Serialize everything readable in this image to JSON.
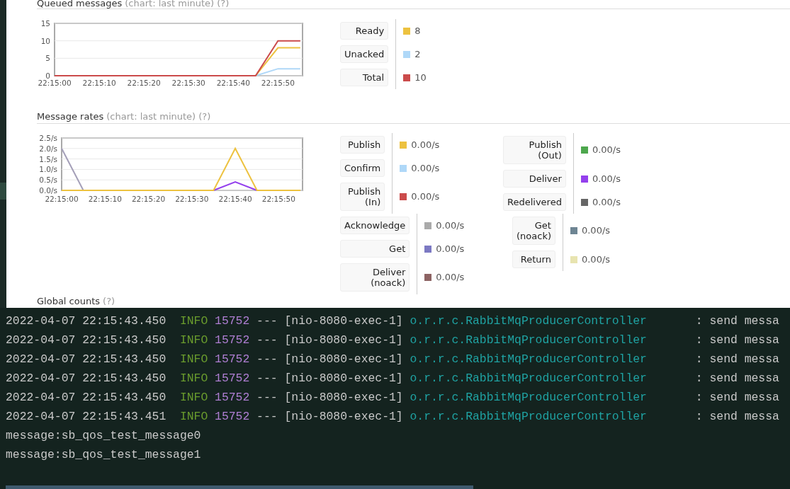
{
  "browser": {
    "sections": [
      {
        "title": "Queued messages",
        "note": "(chart: last minute)",
        "help": "(?)",
        "chart_data": {
          "type": "line",
          "categories": [
            "22:15:00",
            null,
            "22:15:10",
            null,
            "22:15:20",
            null,
            "22:15:30",
            null,
            "22:15:40",
            null,
            "22:15:50",
            null
          ],
          "grid": true,
          "ylim": [
            0,
            15
          ],
          "yticks": [
            0,
            5,
            10,
            15
          ],
          "series": [
            {
              "color": "#afd8f8",
              "values": [
                null,
                null,
                null,
                null,
                null,
                null,
                null,
                null,
                null,
                0,
                2,
                2
              ]
            },
            {
              "color": "#edc240",
              "values": [
                null,
                null,
                null,
                null,
                null,
                null,
                null,
                null,
                null,
                0,
                8,
                8
              ]
            },
            {
              "color": "#cb4b4b",
              "values": [
                0,
                0,
                0,
                0,
                0,
                0,
                0,
                0,
                0,
                0,
                10,
                10
              ]
            }
          ]
        },
        "legend_columns": [
          [
            [
              {
                "label": "Ready",
                "color": "#edc240",
                "value": "8"
              },
              {
                "label": "Unacked",
                "color": "#afd8f8",
                "value": "2"
              },
              {
                "label": "Total",
                "color": "#cb4b4b",
                "value": "10"
              }
            ]
          ]
        ]
      },
      {
        "title": "Message rates",
        "note": "(chart: last minute)",
        "help": "(?)",
        "chart_data": {
          "type": "line",
          "categories": [
            "22:15:00",
            null,
            "22:15:10",
            null,
            "22:15:20",
            null,
            "22:15:30",
            null,
            "22:15:40",
            null,
            "22:15:50",
            null
          ],
          "grid": true,
          "ylim": [
            0,
            2.5
          ],
          "yticks": [
            {
              "value": 0,
              "label": "0.0/s"
            },
            {
              "value": 0.5,
              "label": "0.5/s"
            },
            {
              "value": 1,
              "label": "1.0/s"
            },
            {
              "value": 1.5,
              "label": "1.5/s"
            },
            {
              "value": 2,
              "label": "2.0/s"
            },
            {
              "value": 2.5,
              "label": "2.5/s"
            }
          ],
          "series": [
            {
              "color": "#a49fb8",
              "values": [
                2,
                0,
                null,
                null,
                null,
                null,
                null,
                null,
                null,
                null,
                null,
                null
              ]
            },
            {
              "color": "#9440ed",
              "values": [
                null,
                null,
                null,
                null,
                null,
                null,
                null,
                0,
                0.4,
                0,
                null,
                null
              ]
            },
            {
              "color": "#edc240",
              "values": [
                0,
                0,
                0,
                0,
                0,
                0,
                0,
                0,
                2,
                0,
                0,
                0
              ]
            }
          ]
        },
        "legend_columns": [
          [
            [
              {
                "label": "Publish",
                "color": "#edc240",
                "value": "0.00/s"
              },
              {
                "label": "Confirm",
                "color": "#afd8f8",
                "value": "0.00/s"
              },
              {
                "label": "Publish (In)",
                "color": "#cb4b4b",
                "value": "0.00/s"
              }
            ],
            [
              {
                "label": "Acknowledge",
                "color": "#aaaaaa",
                "value": "0.00/s"
              },
              {
                "label": "Get",
                "color": "#7c79c3",
                "value": "0.00/s"
              },
              {
                "label": "Deliver (noack)",
                "color": "#8d6363",
                "value": "0.00/s"
              }
            ]
          ],
          [
            [
              {
                "label": "Publish (Out)",
                "color": "#4da74d",
                "value": "0.00/s"
              },
              {
                "label": "Deliver",
                "color": "#9440ed",
                "value": "0.00/s"
              },
              {
                "label": "Redelivered",
                "color": "#666666",
                "value": "0.00/s"
              }
            ],
            [
              {
                "label": "Get (noack)",
                "color": "#6e8593",
                "value": "0.00/s"
              },
              {
                "label": "Return",
                "color": "#e8e4b0",
                "value": "0.00/s"
              }
            ]
          ]
        ]
      }
    ],
    "next_section": {
      "title": "Global counts",
      "help": "(?)"
    }
  },
  "console": {
    "log_lines": [
      {
        "timestamp": "2022-04-07 22:15:43.450",
        "level": "INFO",
        "pid": "15752",
        "separator": "---",
        "thread": "[nio-8080-exec-1]",
        "logger": "o.r.r.c.RabbitMqProducerController",
        "message": ": send messa"
      },
      {
        "timestamp": "2022-04-07 22:15:43.450",
        "level": "INFO",
        "pid": "15752",
        "separator": "---",
        "thread": "[nio-8080-exec-1]",
        "logger": "o.r.r.c.RabbitMqProducerController",
        "message": ": send messa"
      },
      {
        "timestamp": "2022-04-07 22:15:43.450",
        "level": "INFO",
        "pid": "15752",
        "separator": "---",
        "thread": "[nio-8080-exec-1]",
        "logger": "o.r.r.c.RabbitMqProducerController",
        "message": ": send messa"
      },
      {
        "timestamp": "2022-04-07 22:15:43.450",
        "level": "INFO",
        "pid": "15752",
        "separator": "---",
        "thread": "[nio-8080-exec-1]",
        "logger": "o.r.r.c.RabbitMqProducerController",
        "message": ": send messa"
      },
      {
        "timestamp": "2022-04-07 22:15:43.450",
        "level": "INFO",
        "pid": "15752",
        "separator": "---",
        "thread": "[nio-8080-exec-1]",
        "logger": "o.r.r.c.RabbitMqProducerController",
        "message": ": send messa"
      },
      {
        "timestamp": "2022-04-07 22:15:43.451",
        "level": "INFO",
        "pid": "15752",
        "separator": "---",
        "thread": "[nio-8080-exec-1]",
        "logger": "o.r.r.c.RabbitMqProducerController",
        "message": ": send messa"
      }
    ],
    "output_lines": [
      "message:sb_qos_test_message0",
      "message:sb_qos_test_message1"
    ]
  }
}
